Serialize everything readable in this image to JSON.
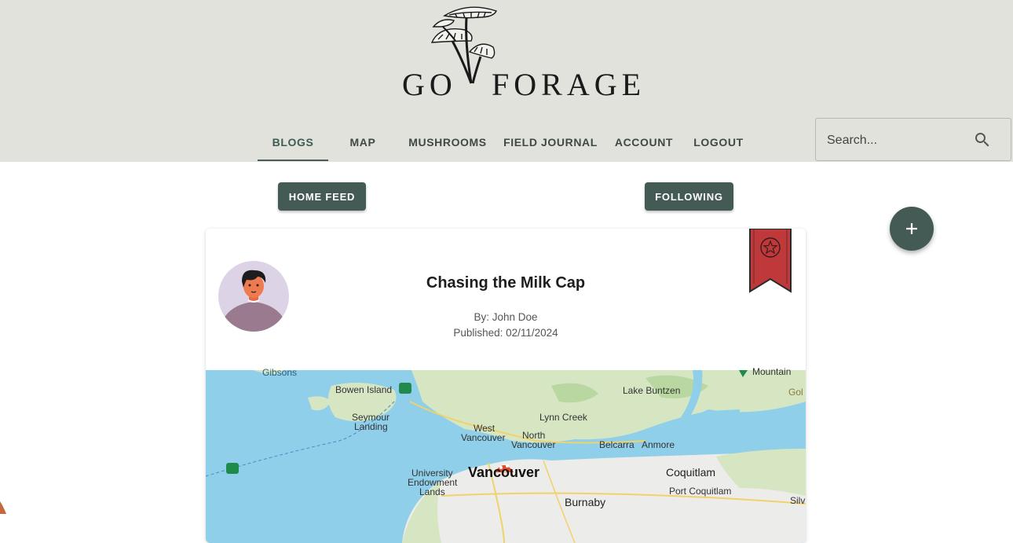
{
  "brand": {
    "word1": "GO",
    "word2": "FORAGE"
  },
  "nav": {
    "items": [
      {
        "label": "BLOGS",
        "active": true
      },
      {
        "label": "MAP"
      },
      {
        "label": "MUSHROOMS"
      },
      {
        "label": "FIELD JOURNAL"
      },
      {
        "label": "ACCOUNT"
      },
      {
        "label": "LOGOUT"
      }
    ]
  },
  "search": {
    "placeholder": "Search...",
    "icon": "search-icon"
  },
  "feed_buttons": {
    "home": "HOME FEED",
    "following": "FOLLOWING"
  },
  "fab": {
    "icon": "plus-icon"
  },
  "post": {
    "title": "Chasing the Milk Cap",
    "author": "By: John Doe",
    "published": "Published: 02/11/2024",
    "bookmark_icon": "bookmark-star-icon"
  },
  "map": {
    "labels": {
      "gibsons": "Gibsons",
      "bowen": "Bowen Island",
      "seymour1": "Seymour",
      "seymour2": "Landing",
      "lakebuntzen": "Lake Buntzen",
      "lynncreek": "Lynn Creek",
      "westvan1": "West",
      "westvan2": "Vancouver",
      "northvan1": "North",
      "northvan2": "Vancouver",
      "belcarra": "Belcarra",
      "anmore": "Anmore",
      "mountain": "Mountain",
      "golden": "Gol",
      "ubc1": "University",
      "ubc2": "Endowment",
      "ubc3": "Lands",
      "vancouver": "Vancouver",
      "coquitlam": "Coquitlam",
      "portcoquitlam": "Port Coquitlam",
      "burnaby": "Burnaby",
      "silver": "Silv"
    },
    "colors": {
      "water": "#8fcfea",
      "land": "#d6e6c3",
      "urban": "#ececea",
      "park": "#b9d7a1"
    }
  },
  "colors": {
    "header_bg": "#e2e2dc",
    "accent": "#445a55",
    "bookmark": "#c0393a"
  }
}
